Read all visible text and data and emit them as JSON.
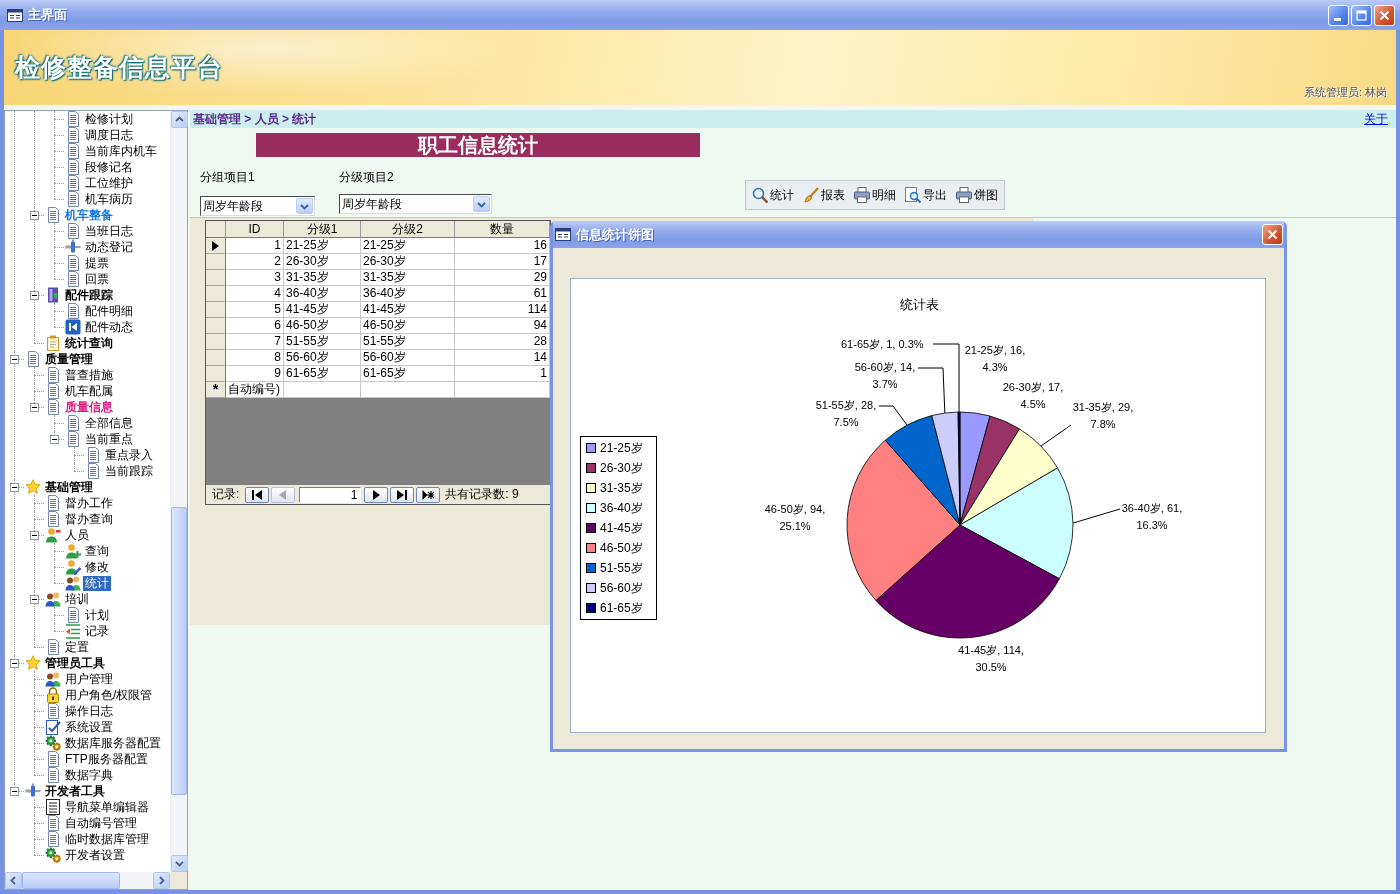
{
  "window": {
    "title": "主界面"
  },
  "header": {
    "title": "检修整备信息平台",
    "user": "系统管理员: 林岗"
  },
  "sidebar": {
    "items": [
      {
        "children": [
          {
            "children": [
              {
                "label": "检修计划",
                "kind": "document",
                "bold": false,
                "selected": false
              },
              {
                "label": "调度日志",
                "kind": "document",
                "bold": false,
                "selected": false
              },
              {
                "label": "当前库内机车",
                "kind": "document",
                "bold": false,
                "selected": false
              },
              {
                "label": "段修记名",
                "kind": "document",
                "bold": false,
                "selected": false
              },
              {
                "label": "工位维护",
                "kind": "document",
                "bold": false,
                "selected": false
              },
              {
                "label": "机车病历",
                "kind": "document",
                "bold": false,
                "selected": false
              }
            ]
          },
          {
            "label": "机车整备",
            "kind": "document",
            "bold": true,
            "color": "#1477e6",
            "selected": false,
            "expanded": true,
            "children": [
              {
                "label": "当班日志",
                "kind": "document",
                "bold": false,
                "selected": false
              },
              {
                "label": "动态登记",
                "kind": "tool",
                "bold": false,
                "selected": false
              },
              {
                "label": "提票",
                "kind": "document",
                "bold": false,
                "selected": false
              },
              {
                "label": "回票",
                "kind": "document",
                "bold": false,
                "selected": false
              }
            ]
          },
          {
            "label": "配件跟踪",
            "kind": "door",
            "bold": true,
            "selected": false,
            "expanded": true,
            "children": [
              {
                "label": "配件明细",
                "kind": "document",
                "bold": false,
                "selected": false
              },
              {
                "label": "配件动态",
                "kind": "back",
                "bold": false,
                "selected": false
              }
            ]
          },
          {
            "label": "统计查询",
            "kind": "notepad",
            "bold": true,
            "selected": false
          }
        ]
      },
      {
        "label": "质量管理",
        "kind": "document",
        "bold": true,
        "selected": false,
        "expanded": true,
        "children": [
          {
            "label": "普查措施",
            "kind": "document",
            "bold": false,
            "selected": false
          },
          {
            "label": "机车配属",
            "kind": "document",
            "bold": false,
            "selected": false
          },
          {
            "label": "质量信息",
            "kind": "document",
            "bold": true,
            "color": "#e01a82",
            "selected": false,
            "expanded": true,
            "children": [
              {
                "label": "全部信息",
                "kind": "document",
                "bold": false,
                "selected": false
              },
              {
                "label": "当前重点",
                "kind": "document",
                "bold": false,
                "selected": false,
                "expanded": true,
                "children": [
                  {
                    "label": "重点录入",
                    "kind": "document",
                    "bold": false,
                    "selected": false
                  },
                  {
                    "label": "当前跟踪",
                    "kind": "document",
                    "bold": false,
                    "selected": false
                  }
                ]
              }
            ]
          }
        ]
      },
      {
        "label": "基础管理",
        "kind": "star",
        "bold": true,
        "selected": false,
        "expanded": true,
        "children": [
          {
            "label": "督办工作",
            "kind": "document",
            "bold": false,
            "selected": false
          },
          {
            "label": "督办查询",
            "kind": "document",
            "bold": false,
            "selected": false
          },
          {
            "label": "人员",
            "kind": "person",
            "bold": false,
            "selected": false,
            "expanded": true,
            "children": [
              {
                "label": "查询",
                "kind": "person-add",
                "bold": false,
                "selected": false
              },
              {
                "label": "修改",
                "kind": "person-edit",
                "bold": false,
                "selected": false
              },
              {
                "label": "统计",
                "kind": "people",
                "bold": false,
                "selected": true
              }
            ]
          },
          {
            "label": "培训",
            "kind": "people",
            "bold": false,
            "selected": false,
            "expanded": true,
            "children": [
              {
                "label": "计划",
                "kind": "document",
                "bold": false,
                "selected": false
              },
              {
                "label": "记录",
                "kind": "list-arrow",
                "bold": false,
                "selected": false
              }
            ]
          },
          {
            "label": "定置",
            "kind": "document",
            "bold": false,
            "selected": false
          }
        ]
      },
      {
        "label": "管理员工具",
        "kind": "star",
        "bold": true,
        "selected": false,
        "expanded": true,
        "children": [
          {
            "label": "用户管理",
            "kind": "people",
            "bold": false,
            "selected": false
          },
          {
            "label": "用户角色/权限管",
            "kind": "lock",
            "bold": false,
            "selected": false
          },
          {
            "label": "操作日志",
            "kind": "document",
            "bold": false,
            "selected": false
          },
          {
            "label": "系统设置",
            "kind": "form-check",
            "bold": false,
            "selected": false
          },
          {
            "label": "数据库服务器配置",
            "kind": "database-gear",
            "bold": false,
            "selected": false
          },
          {
            "label": "FTP服务器配置",
            "kind": "document",
            "bold": false,
            "selected": false
          },
          {
            "label": "数据字典",
            "kind": "document",
            "bold": false,
            "selected": false
          }
        ]
      },
      {
        "label": "开发者工具",
        "kind": "tool",
        "bold": true,
        "selected": false,
        "expanded": true,
        "children": [
          {
            "label": "导航菜单编辑器",
            "kind": "list",
            "bold": false,
            "selected": false
          },
          {
            "label": "自动编号管理",
            "kind": "document",
            "bold": false,
            "selected": false
          },
          {
            "label": "临时数据库管理",
            "kind": "document",
            "bold": false,
            "selected": false
          },
          {
            "label": "开发者设置",
            "kind": "database-gear",
            "bold": false,
            "selected": false
          }
        ]
      }
    ]
  },
  "breadcrumb": "基础管理 > 人员 > 统计",
  "about_link": "关于",
  "form": {
    "title": "职工信息统计",
    "fields": [
      {
        "label": "分组项目1",
        "value": "周岁年龄段"
      },
      {
        "label": "分级项目2",
        "value": "周岁年龄段"
      }
    ],
    "toolbar": [
      {
        "kind": "search",
        "label": "统计"
      },
      {
        "kind": "brush",
        "label": "报表"
      },
      {
        "kind": "printer",
        "label": "明细"
      },
      {
        "kind": "preview",
        "label": "导出"
      },
      {
        "kind": "printer",
        "label": "饼图"
      }
    ]
  },
  "table": {
    "columns": [
      "ID",
      "分级1",
      "分级2",
      "数量"
    ],
    "rows": [
      {
        "current": true,
        "cells": [
          "1",
          "21-25岁",
          "21-25岁",
          "16"
        ]
      },
      {
        "current": false,
        "cells": [
          "2",
          "26-30岁",
          "26-30岁",
          "17"
        ]
      },
      {
        "current": false,
        "cells": [
          "3",
          "31-35岁",
          "31-35岁",
          "29"
        ]
      },
      {
        "current": false,
        "cells": [
          "4",
          "36-40岁",
          "36-40岁",
          "61"
        ]
      },
      {
        "current": false,
        "cells": [
          "5",
          "41-45岁",
          "41-45岁",
          "114"
        ]
      },
      {
        "current": false,
        "cells": [
          "6",
          "46-50岁",
          "46-50岁",
          "94"
        ]
      },
      {
        "current": false,
        "cells": [
          "7",
          "51-55岁",
          "51-55岁",
          "28"
        ]
      },
      {
        "current": false,
        "cells": [
          "8",
          "56-60岁",
          "56-60岁",
          "14"
        ]
      },
      {
        "current": false,
        "cells": [
          "9",
          "61-65岁",
          "61-65岁",
          "1"
        ]
      }
    ],
    "new_row": {
      "marker": "*",
      "cells": [
        "自动编号)"
      ]
    }
  },
  "navigation": {
    "label": "记录:",
    "controls": [
      {
        "kind": "first",
        "disabled": false
      },
      {
        "kind": "previous",
        "disabled": true
      },
      {
        "kind": "field",
        "value": "1"
      },
      {
        "kind": "next",
        "disabled": false
      },
      {
        "kind": "last",
        "disabled": false
      },
      {
        "kind": "new",
        "disabled": false
      }
    ],
    "total": "共有记录数: 9"
  },
  "dialog": {
    "title": "信息统计饼图",
    "chart_data": {
      "type": "pie",
      "title": "统计表",
      "categories": [
        "21-25岁",
        "26-30岁",
        "31-35岁",
        "36-40岁",
        "41-45岁",
        "46-50岁",
        "51-55岁",
        "56-60岁",
        "61-65岁"
      ],
      "values": [
        16,
        17,
        29,
        61,
        114,
        94,
        28,
        14,
        1
      ],
      "colors": [
        "#9999ff",
        "#993366",
        "#ffffcc",
        "#ccffff",
        "#660066",
        "#ff8080",
        "#0066cc",
        "#ccccff",
        "#000080"
      ],
      "legend": "left",
      "data_labels": true,
      "value_labels": [
        "21-25岁, 16, 4.3%",
        "26-30岁, 17, 4.5%",
        "31-35岁, 29, 7.8%",
        "36-40岁, 61, 16.3%",
        "41-45岁, 114, 30.5%",
        "46-50岁, 94, 25.1%",
        "51-55岁, 28, 7.5%",
        "56-60岁, 14, 3.7%",
        "61-65岁, 1, 0.3%"
      ]
    }
  }
}
